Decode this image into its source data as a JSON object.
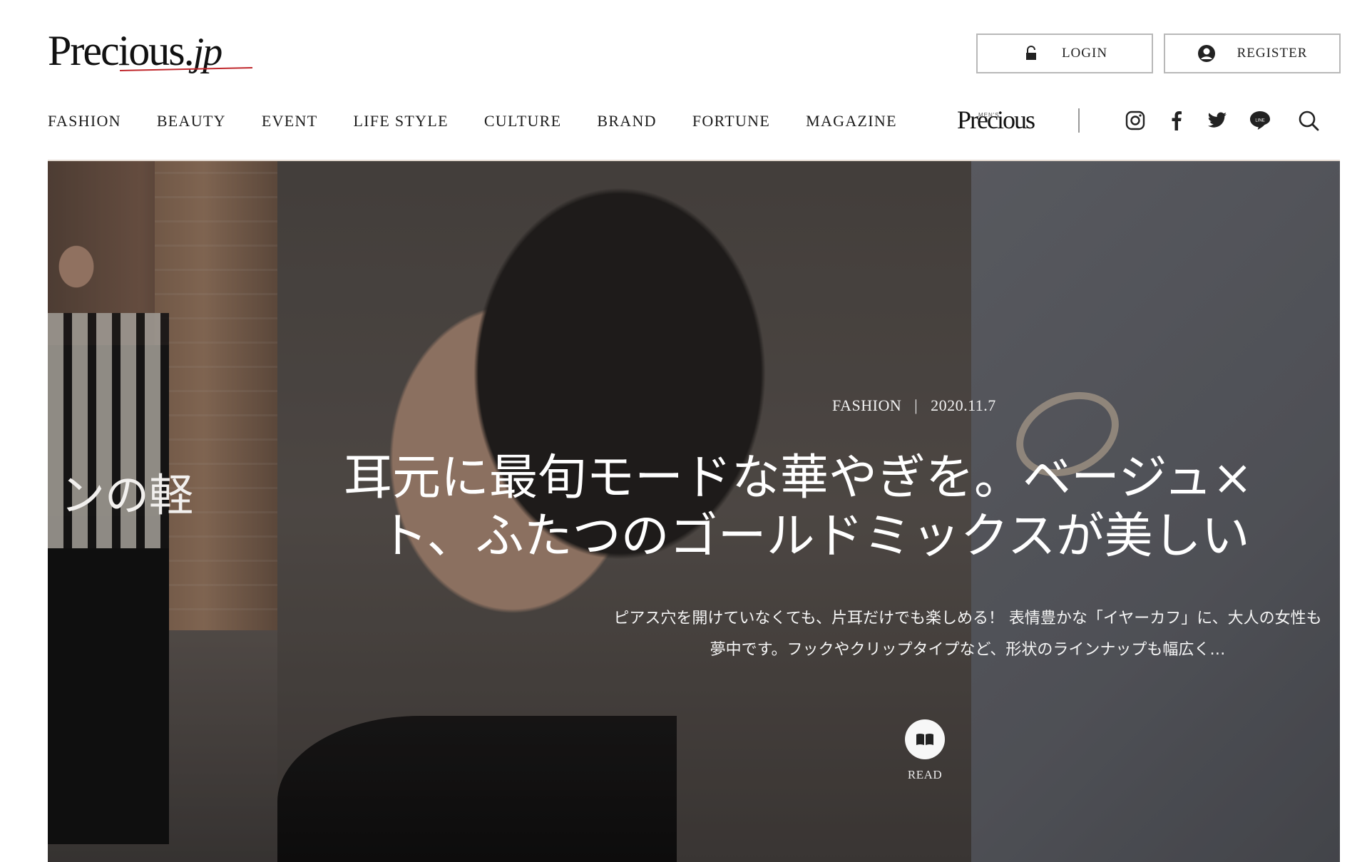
{
  "header": {
    "logo_main": "Precious.",
    "logo_jp": "jp",
    "login_label": "LOGIN",
    "register_label": "REGISTER",
    "nav": [
      "FASHION",
      "BEAUTY",
      "EVENT",
      "LIFE STYLE",
      "CULTURE",
      "BRAND",
      "FORTUNE",
      "MAGAZINE"
    ],
    "mens_logo": "Precious",
    "mens_small": "MEN'S",
    "social_icons": [
      "instagram-icon",
      "facebook-icon",
      "twitter-icon",
      "line-icon",
      "search-icon"
    ]
  },
  "hero": {
    "left_caption": "ンの軽",
    "category": "FASHION",
    "separator": "|",
    "date": "2020.11.7",
    "title_line1": "耳元に最旬モードな華やぎを。ベージュ×",
    "title_line2": "ト、ふたつのゴールドミックスが美しい",
    "excerpt": "ピアス穴を開けていなくても、片耳だけでも楽しめる！ 表情豊かな「イヤーカフ」に、大人の女性も夢中です。フックやクリップタイプなど、形状のラインナップも幅広く…",
    "read_label": "READ"
  },
  "colors": {
    "accent_red": "#c0282d",
    "border_gray": "#b8b8b8",
    "text_dark": "#1c1c1c"
  }
}
